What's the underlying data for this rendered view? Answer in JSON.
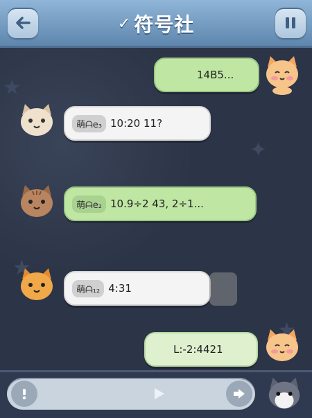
{
  "header": {
    "title": "符号社",
    "logo_glyph": "✓",
    "back_icon": "back-arrow-icon",
    "pause_icon": "pause-icon",
    "bar_color": "#6f95bb"
  },
  "messages": [
    {
      "side": "right",
      "style": "green",
      "tag": "",
      "text": "14B5...",
      "avatar": "orange-cat-blush"
    },
    {
      "side": "left",
      "style": "white",
      "tag": "萌ᗩe₃",
      "text": "10:20 11?",
      "avatar": "cream-cat"
    },
    {
      "side": "left",
      "style": "green",
      "tag": "萌ᗩe₂",
      "text": "10.9÷2  43, 2÷1...",
      "avatar": "brown-tabby-cat"
    },
    {
      "side": "left",
      "style": "white",
      "tag": "萌ᗩ₁₂",
      "text": "4:31",
      "avatar": "orange-cat"
    },
    {
      "side": "right",
      "style": "lightgreen",
      "tag": "",
      "text": "L:-2:4421",
      "avatar": "orange-cat-blush"
    }
  ],
  "input": {
    "info_icon": "info-icon",
    "send_icon": "play-triangle-icon",
    "sticker_icon": "speaker-arrow-icon",
    "avatar": "gray-white-cat"
  }
}
